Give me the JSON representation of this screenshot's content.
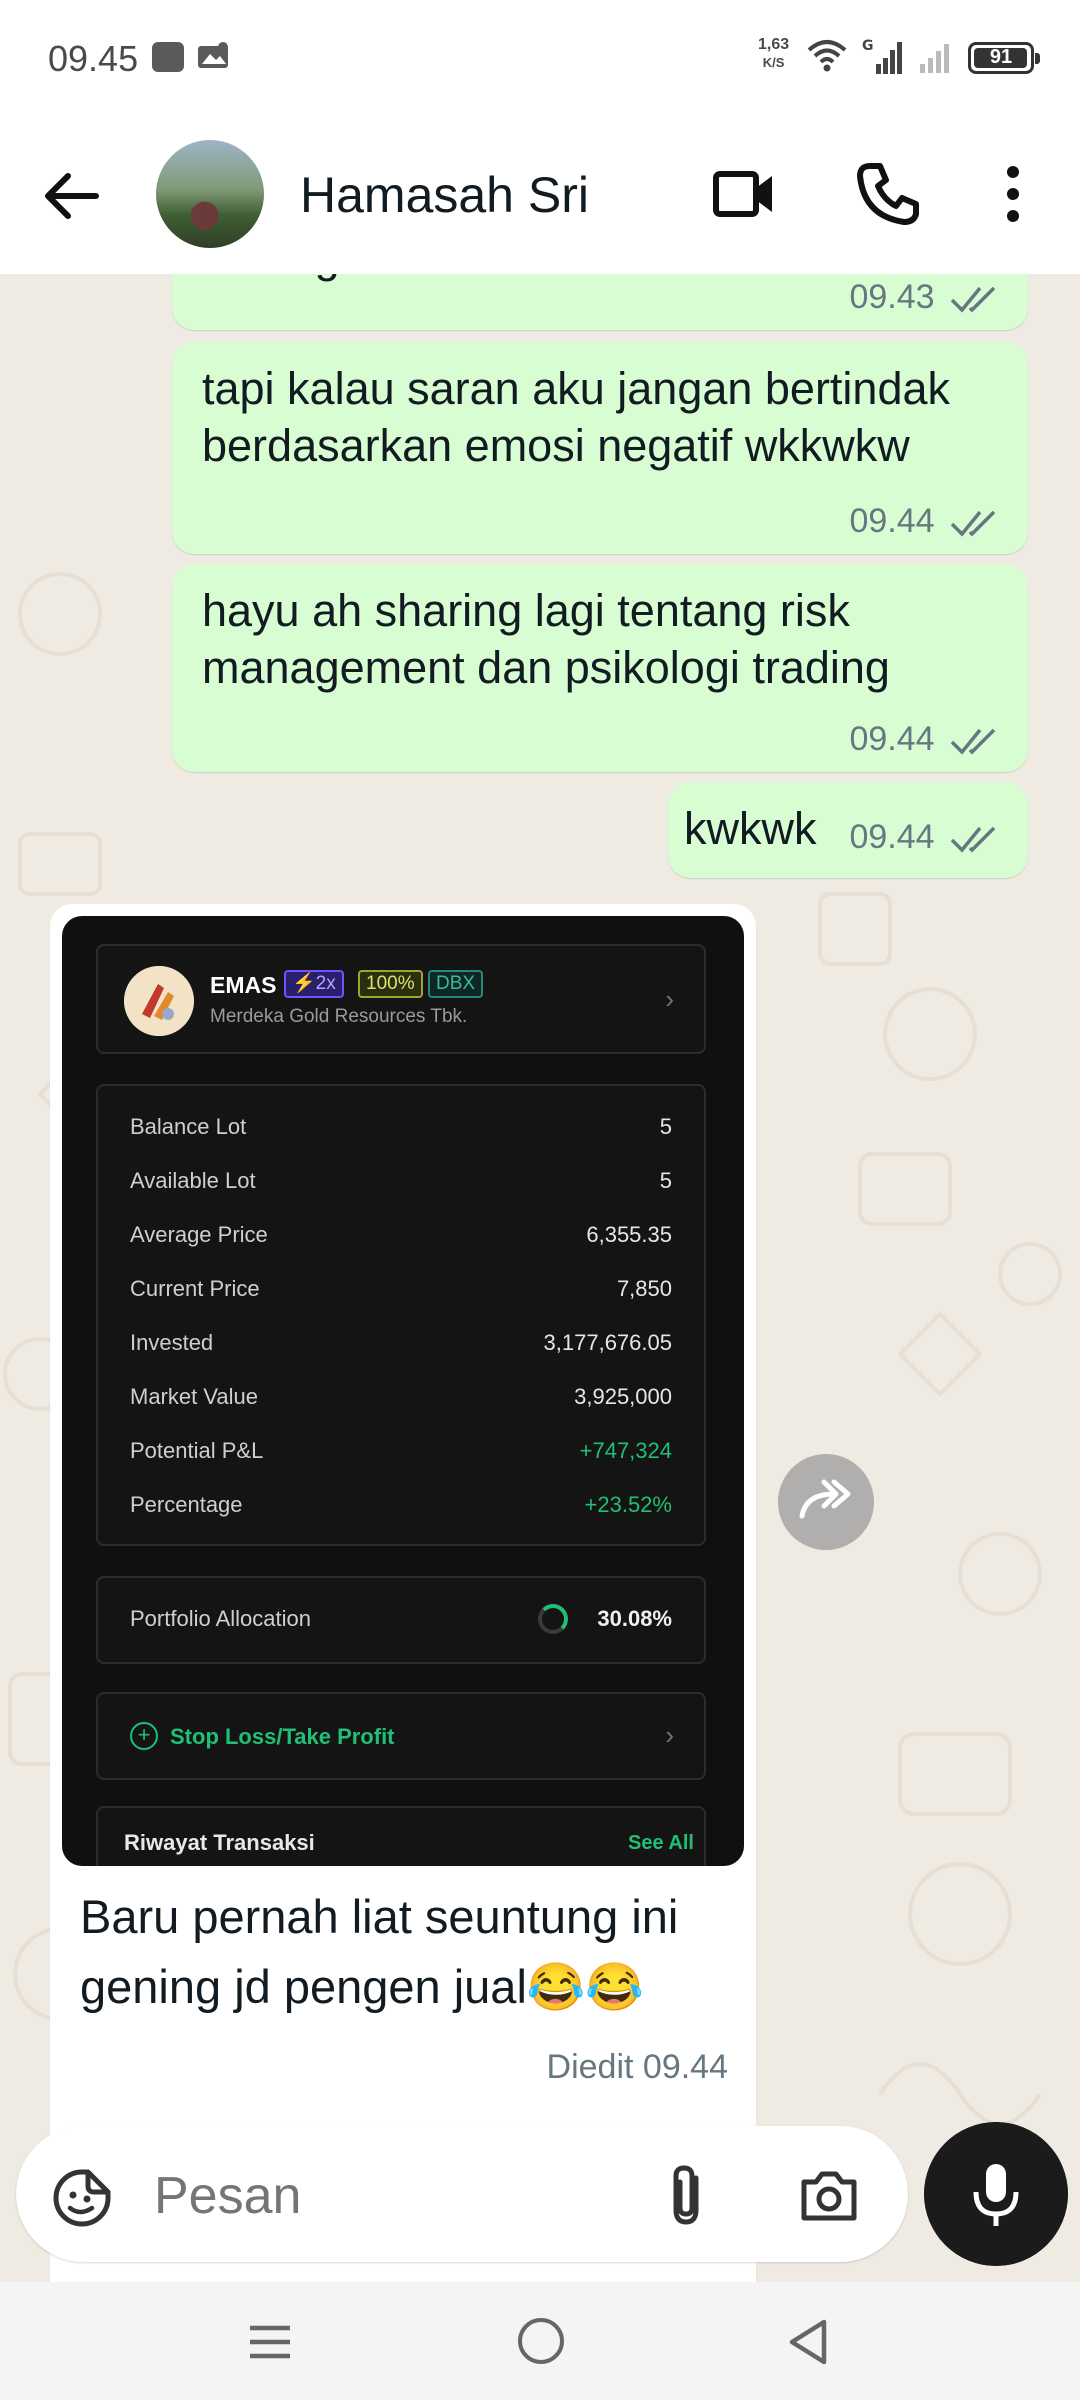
{
  "status_bar": {
    "time": "09.45",
    "net_speed_value": "1,63",
    "net_speed_unit": "K/S",
    "network_label": "G",
    "battery": "91"
  },
  "header": {
    "contact_name": "Hamasah Sri",
    "icons": [
      "back-arrow-icon",
      "avatar",
      "video-call-icon",
      "phone-icon",
      "more-vert-icon"
    ]
  },
  "messages": [
    {
      "direction": "out",
      "text": "untung mah",
      "time": "09.43",
      "status": "read"
    },
    {
      "direction": "out",
      "text": "tapi kalau saran aku jangan bertindak berdasarkan emosi negatif wkkwkw",
      "time": "09.44",
      "status": "read"
    },
    {
      "direction": "out",
      "text": "hayu ah sharing lagi tentang risk management dan psikologi trading",
      "time": "09.44",
      "status": "read"
    },
    {
      "direction": "out",
      "text": "kwkwk",
      "time": "09.44",
      "status": "read"
    },
    {
      "direction": "in",
      "caption": "Baru pernah liat seuntung ini gening jd pengen jual😂😂",
      "edited_label": "Diedit",
      "time": "09.44"
    }
  ],
  "screenshot": {
    "stock_code": "EMAS",
    "tags": [
      "⚡2x",
      "100%",
      "DBX"
    ],
    "company": "Merdeka Gold Resources Tbk.",
    "rows": [
      {
        "label": "Balance Lot",
        "value": "5"
      },
      {
        "label": "Available Lot",
        "value": "5"
      },
      {
        "label": "Average Price",
        "value": "6,355.35"
      },
      {
        "label": "Current Price",
        "value": "7,850"
      },
      {
        "label": "Invested",
        "value": "3,177,676.05"
      },
      {
        "label": "Market Value",
        "value": "3,925,000"
      },
      {
        "label": "Potential P&L",
        "value": "+747,324"
      },
      {
        "label": "Percentage",
        "value": "+23.52%"
      }
    ],
    "portfolio_allocation_label": "Portfolio Allocation",
    "portfolio_allocation_value": "30.08%",
    "stop_loss_label": "Stop Loss/Take Profit",
    "history_label": "Riwayat Transaksi",
    "see_all_label": "See All"
  },
  "input": {
    "placeholder": "Pesan"
  },
  "colors": {
    "outgoing_bubble": "#d9fdd3",
    "incoming_bubble": "#ffffff",
    "chat_bg": "#efeae2",
    "profit_green": "#1fbf75"
  }
}
